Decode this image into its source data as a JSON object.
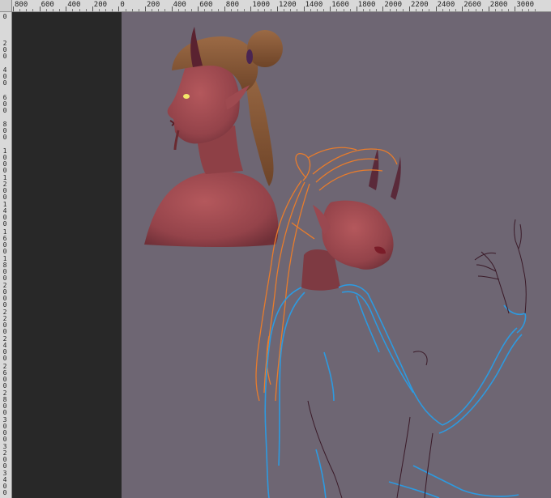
{
  "rulers": {
    "top_labels": [
      "800",
      "600",
      "400",
      "200",
      "0",
      "200",
      "400",
      "600",
      "800",
      "1000",
      "1200",
      "1400",
      "1600",
      "1800",
      "2000",
      "2200",
      "2400",
      "2600",
      "2800",
      "3000"
    ],
    "left_labels": [
      "0",
      "200",
      "400",
      "600",
      "800",
      "1000",
      "1200",
      "1400",
      "1600",
      "1800",
      "2000",
      "2200",
      "2400",
      "2600",
      "2800",
      "3000",
      "3200",
      "3400"
    ]
  },
  "canvas": {
    "background_color": "#6e6673",
    "pasteboard_color": "#282828"
  },
  "artwork": {
    "layers": [
      "painted-demon-portrait",
      "sketch-orange-hair",
      "sketch-blue-body",
      "sketch-dark-outline"
    ],
    "colors": {
      "skin": "#9c4a50",
      "hair": "#8a5a38",
      "horn": "#5a2230",
      "eye_glow": "#f3e86a",
      "orange_sketch": "#e87c2c",
      "blue_sketch": "#2d9ae0",
      "dark_sketch": "#3a1a28"
    }
  }
}
